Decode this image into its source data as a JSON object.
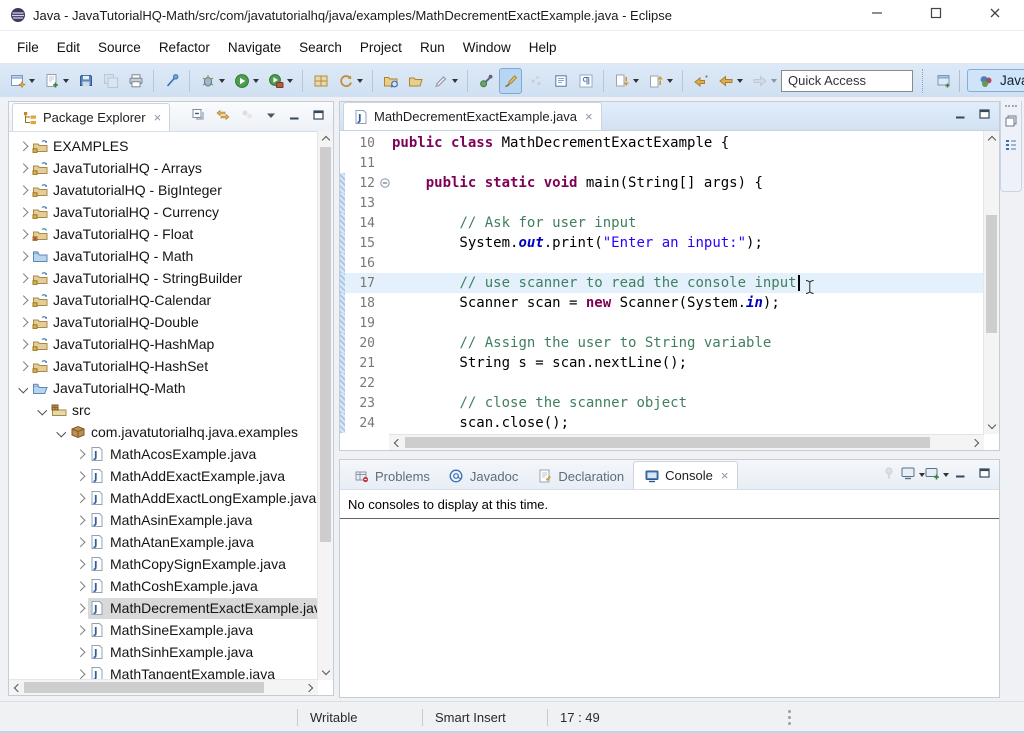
{
  "window": {
    "title": "Java - JavaTutorialHQ-Math/src/com/javatutorialhq/java/examples/MathDecrementExactExample.java - Eclipse",
    "controls": [
      "minimize",
      "maximize",
      "close"
    ]
  },
  "menubar": [
    "File",
    "Edit",
    "Source",
    "Refactor",
    "Navigate",
    "Search",
    "Project",
    "Run",
    "Window",
    "Help"
  ],
  "toolbar": {
    "quick_access": "Quick Access",
    "perspective_label": "Java",
    "items": [
      {
        "name": "new-wizard",
        "dd": true
      },
      {
        "name": "new-java-class",
        "dd": true
      },
      {
        "name": "save"
      },
      {
        "name": "save-all",
        "disabled": true
      },
      {
        "name": "print"
      },
      {
        "name": "sep"
      },
      {
        "name": "skip-breakpoints"
      },
      {
        "name": "sep"
      },
      {
        "name": "debug",
        "dd": true
      },
      {
        "name": "run",
        "dd": true
      },
      {
        "name": "external-tools",
        "dd": true
      },
      {
        "name": "sep"
      },
      {
        "name": "new-java-project"
      },
      {
        "name": "update-project",
        "dd": true
      },
      {
        "name": "sep"
      },
      {
        "name": "open-type"
      },
      {
        "name": "open-resource"
      },
      {
        "name": "annotate",
        "dd": true
      },
      {
        "name": "sep"
      },
      {
        "name": "search"
      },
      {
        "name": "mark-occurrences",
        "active": true
      },
      {
        "name": "format",
        "disabled": true
      },
      {
        "name": "open-declaration"
      },
      {
        "name": "show-whitespace"
      },
      {
        "name": "sep"
      },
      {
        "name": "next-annotation",
        "dd": true
      },
      {
        "name": "prev-annotation",
        "dd": true
      },
      {
        "name": "sep"
      },
      {
        "name": "last-edit"
      },
      {
        "name": "back",
        "dd": true
      },
      {
        "name": "forward",
        "dd": true,
        "disabled": true
      }
    ]
  },
  "package_explorer": {
    "tab_label": "Package Explorer",
    "tools": [
      {
        "name": "collapse-all"
      },
      {
        "name": "link-with-editor"
      },
      {
        "name": "focus",
        "disabled": true
      },
      {
        "name": "view-menu"
      },
      {
        "name": "min-view"
      },
      {
        "name": "max-view"
      }
    ],
    "items": [
      {
        "level": 0,
        "chevron": "right",
        "icon": "project",
        "label": "EXAMPLES"
      },
      {
        "level": 0,
        "chevron": "right",
        "icon": "project",
        "label": "JavaTutorialHQ - Arrays"
      },
      {
        "level": 0,
        "chevron": "right",
        "icon": "project",
        "label": "JavatutorialHQ - BigInteger"
      },
      {
        "level": 0,
        "chevron": "right",
        "icon": "project",
        "label": "JavaTutorialHQ - Currency"
      },
      {
        "level": 0,
        "chevron": "right",
        "icon": "project-error",
        "label": "JavaTutorialHQ - Float"
      },
      {
        "level": 0,
        "chevron": "right",
        "icon": "project-plain",
        "label": "JavaTutorialHQ - Math"
      },
      {
        "level": 0,
        "chevron": "right",
        "icon": "project",
        "label": "JavaTutorialHQ - StringBuilder"
      },
      {
        "level": 0,
        "chevron": "right",
        "icon": "project",
        "label": "JavaTutorialHQ-Calendar"
      },
      {
        "level": 0,
        "chevron": "right",
        "icon": "project",
        "label": "JavaTutorialHQ-Double"
      },
      {
        "level": 0,
        "chevron": "right",
        "icon": "project",
        "label": "JavaTutorialHQ-HashMap"
      },
      {
        "level": 0,
        "chevron": "right",
        "icon": "project",
        "label": "JavaTutorialHQ-HashSet"
      },
      {
        "level": 0,
        "chevron": "down",
        "icon": "project-open",
        "label": "JavaTutorialHQ-Math"
      },
      {
        "level": 1,
        "chevron": "down",
        "icon": "src-folder",
        "label": "src"
      },
      {
        "level": 2,
        "chevron": "down",
        "icon": "package",
        "label": "com.javatutorialhq.java.examples"
      },
      {
        "level": 3,
        "chevron": "right",
        "icon": "java-file",
        "label": "MathAcosExample.java"
      },
      {
        "level": 3,
        "chevron": "right",
        "icon": "java-file",
        "label": "MathAddExactExample.java"
      },
      {
        "level": 3,
        "chevron": "right",
        "icon": "java-file",
        "label": "MathAddExactLongExample.java"
      },
      {
        "level": 3,
        "chevron": "right",
        "icon": "java-file",
        "label": "MathAsinExample.java"
      },
      {
        "level": 3,
        "chevron": "right",
        "icon": "java-file",
        "label": "MathAtanExample.java"
      },
      {
        "level": 3,
        "chevron": "right",
        "icon": "java-file",
        "label": "MathCopySignExample.java"
      },
      {
        "level": 3,
        "chevron": "right",
        "icon": "java-file",
        "label": "MathCoshExample.java"
      },
      {
        "level": 3,
        "chevron": "right",
        "icon": "java-file",
        "label": "MathDecrementExactExample.java",
        "selected": true
      },
      {
        "level": 3,
        "chevron": "right",
        "icon": "java-file",
        "label": "MathSineExample.java"
      },
      {
        "level": 3,
        "chevron": "right",
        "icon": "java-file",
        "label": "MathSinhExample.java"
      },
      {
        "level": 3,
        "chevron": "right",
        "icon": "java-file",
        "label": "MathTangentExample.java"
      }
    ]
  },
  "editor": {
    "tab_label": "MathDecrementExactExample.java",
    "tools": [
      {
        "name": "min-view"
      },
      {
        "name": "max-view"
      }
    ],
    "range_start_line": 12,
    "lines": [
      {
        "n": "10",
        "segs": [
          [
            "k",
            "public class "
          ],
          [
            "p",
            "MathDecrementExactExample {"
          ]
        ]
      },
      {
        "n": "11",
        "segs": []
      },
      {
        "n": "12",
        "fold": true,
        "segs": [
          [
            "p",
            "    "
          ],
          [
            "k",
            "public static void "
          ],
          [
            "p",
            "main(String[] args) {"
          ]
        ]
      },
      {
        "n": "13",
        "segs": []
      },
      {
        "n": "14",
        "segs": [
          [
            "p",
            "        "
          ],
          [
            "c",
            "// Ask for user input"
          ]
        ]
      },
      {
        "n": "15",
        "segs": [
          [
            "p",
            "        System."
          ],
          [
            "f",
            "out"
          ],
          [
            "p",
            ".print("
          ],
          [
            "s",
            "\"Enter an input:\""
          ],
          [
            "p",
            ");"
          ]
        ]
      },
      {
        "n": "16",
        "segs": []
      },
      {
        "n": "17",
        "current": true,
        "caret": true,
        "segs": [
          [
            "p",
            "        "
          ],
          [
            "c",
            "// use scanner to read the console input"
          ]
        ]
      },
      {
        "n": "18",
        "segs": [
          [
            "p",
            "        Scanner scan = "
          ],
          [
            "k",
            "new"
          ],
          [
            "p",
            " Scanner(System."
          ],
          [
            "f",
            "in"
          ],
          [
            "p",
            ");"
          ]
        ]
      },
      {
        "n": "19",
        "segs": []
      },
      {
        "n": "20",
        "segs": [
          [
            "p",
            "        "
          ],
          [
            "c",
            "// Assign the user to String variable"
          ]
        ]
      },
      {
        "n": "21",
        "segs": [
          [
            "p",
            "        String s = scan.nextLine();"
          ]
        ]
      },
      {
        "n": "22",
        "segs": []
      },
      {
        "n": "23",
        "segs": [
          [
            "p",
            "        "
          ],
          [
            "c",
            "// close the scanner object"
          ]
        ]
      },
      {
        "n": "24",
        "segs": [
          [
            "p",
            "        scan.close();"
          ]
        ]
      }
    ]
  },
  "console": {
    "tabs": [
      {
        "label": "Problems",
        "icon": "problems"
      },
      {
        "label": "Javadoc",
        "icon": "javadoc"
      },
      {
        "label": "Declaration",
        "icon": "declaration"
      },
      {
        "label": "Console",
        "icon": "console-tab",
        "active": true
      }
    ],
    "tools": [
      {
        "name": "pin-console",
        "disabled": true
      },
      {
        "name": "display-console",
        "dd": true
      },
      {
        "name": "open-console",
        "dd": true
      },
      {
        "name": "min-view"
      },
      {
        "name": "max-view"
      }
    ],
    "message": "No consoles to display at this time."
  },
  "right_rail": {
    "items": [
      {
        "name": "restore-stack"
      },
      {
        "name": "outline-view"
      }
    ]
  },
  "statusbar": {
    "writable": "Writable",
    "input_mode": "Smart Insert",
    "position": "17 : 49"
  },
  "colors": {
    "keyword": "#7f0055",
    "comment": "#3f7f5f",
    "string": "#2a00ff",
    "static_field": "#0000c0",
    "current_line": "#e4f1fc",
    "selection": "#d9d9d9",
    "toolbar_bg": "#d7e5f4"
  }
}
